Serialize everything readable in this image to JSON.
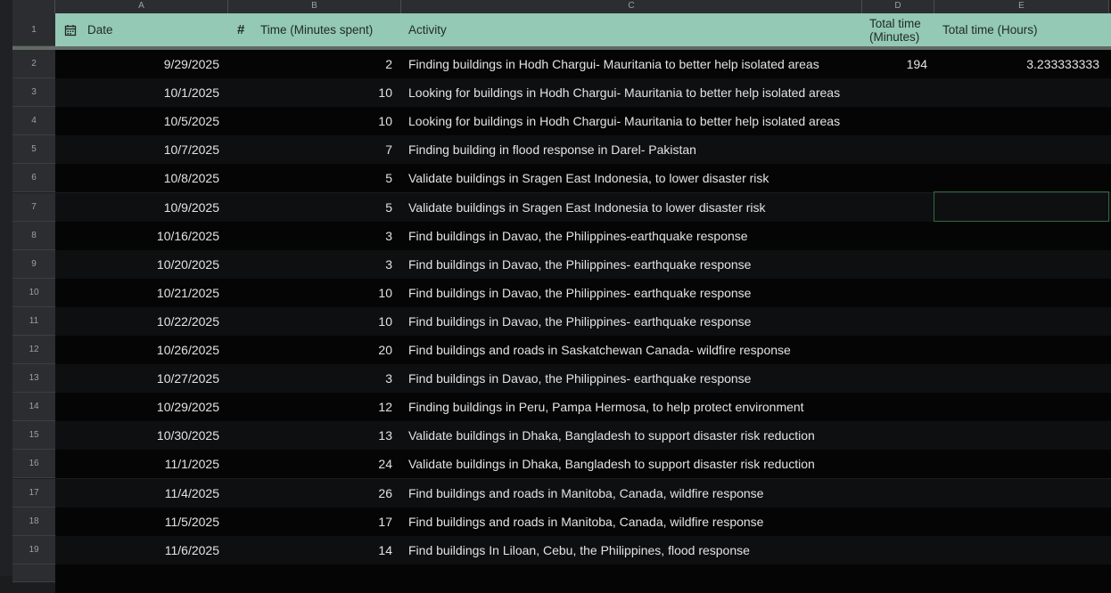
{
  "columns": [
    "A",
    "B",
    "C",
    "D",
    "E"
  ],
  "header": {
    "date": "Date",
    "minutes": "Time (Minutes spent)",
    "activity": "Activity",
    "total_min": "Total time (Minutes)",
    "total_hours": "Total time (Hours)"
  },
  "rows": [
    {
      "n": "2",
      "date": "9/29/2025",
      "min": "2",
      "act": "Finding buildings in Hodh Chargui- Mauritania to better help isolated areas",
      "tmin": "194",
      "thr": "3.233333333"
    },
    {
      "n": "3",
      "date": "10/1/2025",
      "min": "10",
      "act": "Looking for buildings in Hodh Chargui- Mauritania to better help isolated areas"
    },
    {
      "n": "4",
      "date": "10/5/2025",
      "min": "10",
      "act": "Looking for buildings in Hodh Chargui- Mauritania to better help isolated areas"
    },
    {
      "n": "5",
      "date": "10/7/2025",
      "min": "7",
      "act": "Finding building in flood response in Darel- Pakistan"
    },
    {
      "n": "6",
      "date": "10/8/2025",
      "min": "5",
      "act": "Validate buildings in Sragen East Indonesia, to lower disaster risk"
    },
    {
      "n": "7",
      "date": "10/9/2025",
      "min": "5",
      "act": "Validate buildings in Sragen East Indonesia to lower disaster risk"
    },
    {
      "n": "8",
      "date": "10/16/2025",
      "min": "3",
      "act": "Find buildings in Davao, the Philippines-earthquake response"
    },
    {
      "n": "9",
      "date": "10/20/2025",
      "min": "3",
      "act": "Find buildings in Davao, the Philippines- earthquake response"
    },
    {
      "n": "10",
      "date": "10/21/2025",
      "min": "10",
      "act": "Find buildings in Davao, the Philippines- earthquake response"
    },
    {
      "n": "11",
      "date": "10/22/2025",
      "min": "10",
      "act": "Find buildings in Davao, the Philippines- earthquake response"
    },
    {
      "n": "12",
      "date": "10/26/2025",
      "min": "20",
      "act": "Find buildings and roads in Saskatchewan Canada- wildfire response"
    },
    {
      "n": "13",
      "date": "10/27/2025",
      "min": "3",
      "act": "Find buildings in Davao, the Philippines- earthquake response"
    },
    {
      "n": "14",
      "date": "10/29/2025",
      "min": "12",
      "act": "Finding buildings in Peru, Pampa Hermosa, to help protect environment"
    },
    {
      "n": "15",
      "date": "10/30/2025",
      "min": "13",
      "act": "Validate buildings in Dhaka, Bangladesh to support disaster risk reduction"
    },
    {
      "n": "16",
      "date": "11/1/2025",
      "min": "24",
      "act": "Validate buildings in Dhaka, Bangladesh to support disaster risk reduction"
    },
    {
      "n": "17",
      "date": "11/4/2025",
      "min": "26",
      "act": "Find buildings and roads in Manitoba, Canada, wildfire response"
    },
    {
      "n": "18",
      "date": "11/5/2025",
      "min": "17",
      "act": "Find buildings and roads in Manitoba, Canada, wildfire response"
    },
    {
      "n": "19",
      "date": "11/6/2025",
      "min": "14",
      "act": "Find buildings In Liloan, Cebu, the Philippines, flood response"
    }
  ],
  "header_row_number": "1",
  "colors": {
    "header_bg": "#93c9b5",
    "selection": "#2e6b3f"
  }
}
